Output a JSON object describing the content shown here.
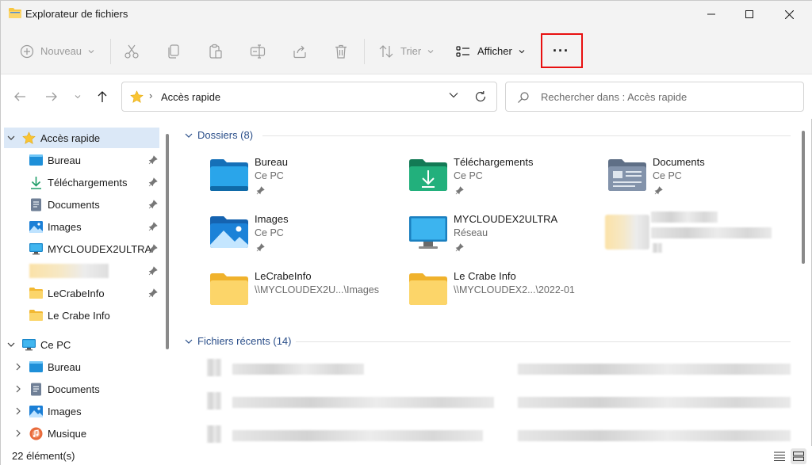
{
  "window": {
    "title": "Explorateur de fichiers"
  },
  "toolbar": {
    "new_label": "Nouveau",
    "sort_label": "Trier",
    "view_label": "Afficher",
    "more_label": "···"
  },
  "navbar": {
    "address": "Accès rapide",
    "search_placeholder": "Rechercher dans : Accès rapide"
  },
  "sidebar": {
    "quick_access_label": "Accès rapide",
    "pinned": [
      {
        "label": "Bureau",
        "icon": "desktop-icon"
      },
      {
        "label": "Téléchargements",
        "icon": "download-icon"
      },
      {
        "label": "Documents",
        "icon": "documents-icon"
      },
      {
        "label": "Images",
        "icon": "pictures-icon"
      },
      {
        "label": "MYCLOUDEX2ULTRA",
        "icon": "monitor-icon"
      },
      {
        "label": "",
        "icon": "folder-icon"
      },
      {
        "label": "LeCrabeInfo",
        "icon": "folder-icon"
      },
      {
        "label": "Le Crabe Info",
        "icon": "folder-icon"
      }
    ],
    "this_pc_label": "Ce PC",
    "this_pc_items": [
      {
        "label": "Bureau",
        "icon": "desktop-icon"
      },
      {
        "label": "Documents",
        "icon": "documents-icon"
      },
      {
        "label": "Images",
        "icon": "pictures-icon"
      },
      {
        "label": "Musique",
        "icon": "music-icon"
      }
    ]
  },
  "main": {
    "folders_header": "Dossiers (8)",
    "folders": [
      {
        "name": "Bureau",
        "location": "Ce PC",
        "pinned": true,
        "icon": "desktop-folder-icon"
      },
      {
        "name": "Téléchargements",
        "location": "Ce PC",
        "pinned": true,
        "icon": "downloads-folder-icon"
      },
      {
        "name": "Documents",
        "location": "Ce PC",
        "pinned": true,
        "icon": "documents-folder-icon"
      },
      {
        "name": "Images",
        "location": "Ce PC",
        "pinned": true,
        "icon": "pictures-folder-icon"
      },
      {
        "name": "MYCLOUDEX2ULTRA",
        "location": "Réseau",
        "pinned": true,
        "icon": "network-monitor-icon"
      },
      {
        "name": "LeCrabeInfo",
        "location": "\\\\MYCLOUDEX2U...\\Images",
        "pinned": false,
        "icon": "folder-icon"
      },
      {
        "name": "Le Crabe Info",
        "location": "\\\\MYCLOUDEX2...\\2022-01",
        "pinned": false,
        "icon": "folder-icon"
      }
    ],
    "recent_header": "Fichiers récents (14)"
  },
  "status": {
    "count": "22 élément(s)"
  },
  "colors": {
    "accent": "#0067c0",
    "highlight": "#e81010",
    "section": "#2b4f8a",
    "folder": "#f8c741"
  }
}
